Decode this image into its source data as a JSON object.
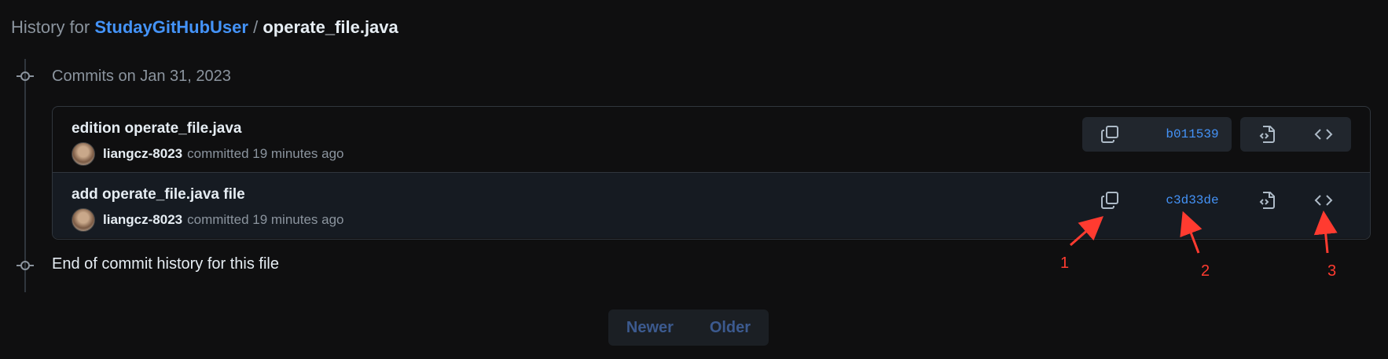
{
  "header": {
    "prefix": "History for",
    "repo": "StudayGitHubUser",
    "separator": "/",
    "file": "operate_file.java"
  },
  "timeline": {
    "group_label": "Commits on Jan 31, 2023",
    "end_label": "End of commit history for this file"
  },
  "commits": [
    {
      "title": "edition operate_file.java",
      "author": "liangcz-8023",
      "action": "committed",
      "time": "19 minutes ago",
      "sha": "b011539"
    },
    {
      "title": "add operate_file.java file",
      "author": "liangcz-8023",
      "action": "committed",
      "time": "19 minutes ago",
      "sha": "c3d33de"
    }
  ],
  "pagination": {
    "newer": "Newer",
    "older": "Older"
  },
  "annotations": {
    "one": "1",
    "two": "2",
    "three": "3"
  },
  "colors": {
    "background": "#0f0f10",
    "link": "#4493f8",
    "annotation": "#ff3b30"
  },
  "icons": [
    "commit-node-icon",
    "copy-icon",
    "file-diff-icon",
    "code-icon",
    "avatar"
  ]
}
